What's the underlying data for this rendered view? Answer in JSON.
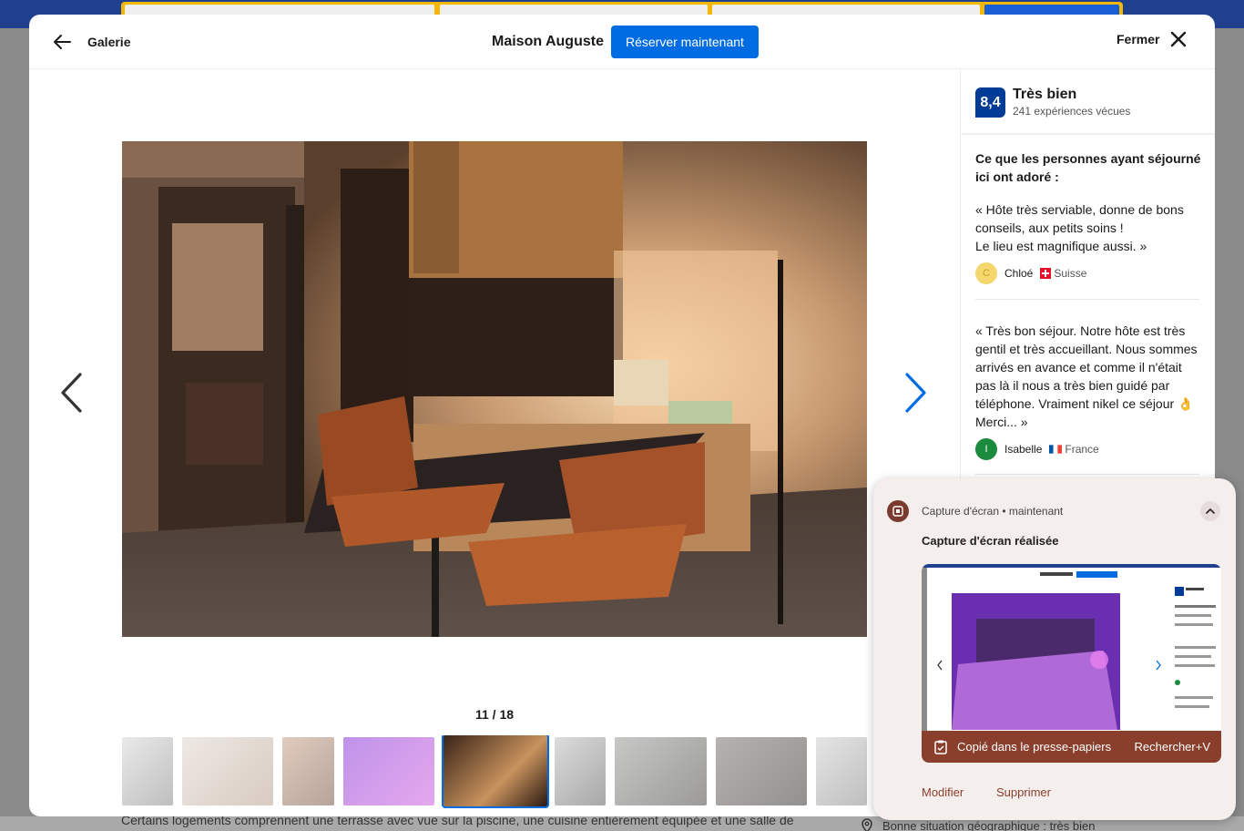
{
  "header": {
    "back_label": "Galerie",
    "property_name": "Maison Auguste",
    "reserve_label": "Réserver maintenant",
    "close_label": "Fermer"
  },
  "gallery": {
    "counter": "11 / 18",
    "thumbnail_count": 9,
    "active_thumbnail": 5
  },
  "rating": {
    "score": "8,4",
    "word": "Très bien",
    "count": "241 expériences vécues"
  },
  "reviews_title": "Ce que les personnes ayant séjourné ici ont adoré :",
  "reviews": [
    {
      "text": "« Hôte très serviable, donne de bons conseils, aux petits soins !\nLe lieu est magnifique aussi. »",
      "name": "Chloé",
      "initial": "C",
      "country": "Suisse",
      "avatar_color": "#f2c94c"
    },
    {
      "text": "« Très bon séjour. Notre hôte est très gentil et très accueillant. Nous sommes arrivés en avance et comme il n'était pas là il nous a très bien guidé par téléphone. Vraiment nikel ce séjour 👌 Merci... »",
      "name": "Isabelle",
      "initial": "I",
      "country": "France",
      "avatar_color": "#1a8a3c"
    }
  ],
  "notification": {
    "app": "Capture d'écran • maintenant",
    "title": "Capture d'écran réalisée",
    "copy_label": "Copié dans le presse-papiers",
    "search_label": "Rechercher+V",
    "edit_label": "Modifier",
    "delete_label": "Supprimer"
  },
  "background": {
    "description": "Certains logements comprennent une terrasse avec vue sur la piscine, une cuisine entièrement équipée et une salle de",
    "location": "Bonne situation géographique : très bien"
  },
  "colors": {
    "primary_blue": "#006ce4",
    "score_blue": "#003b95",
    "notif_accent": "#8a3e2c"
  }
}
